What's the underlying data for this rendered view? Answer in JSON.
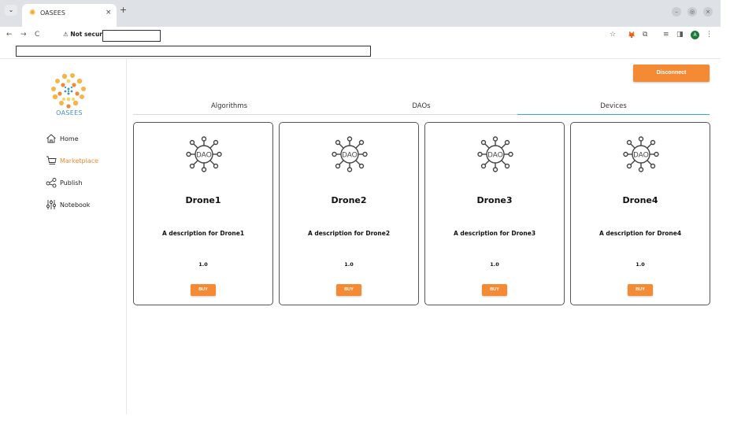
{
  "browser": {
    "tab_menu_icon": "chevron-down-icon",
    "tab_title": "OASEES",
    "tab_close": "×",
    "new_tab": "+",
    "nav": {
      "back": "←",
      "forward": "→",
      "reload": "C"
    },
    "security_label": "⚠ Not secure",
    "window_buttons": [
      "–",
      "◎",
      "×"
    ],
    "toolbar_icons": [
      "☆",
      "🦊",
      "⧉",
      "≡",
      "◨",
      "⋮"
    ],
    "profile_initial": "A"
  },
  "sidebar": {
    "logo_text": "OASEES",
    "items": [
      {
        "label": "Home",
        "icon": "home-icon",
        "active": false
      },
      {
        "label": "Marketplace",
        "icon": "cart-icon",
        "active": true
      },
      {
        "label": "Publish",
        "icon": "share-icon",
        "active": false
      },
      {
        "label": "Notebook",
        "icon": "sliders-icon",
        "active": false
      }
    ]
  },
  "header": {
    "disconnect_label": "Disconnect"
  },
  "tabs": [
    {
      "label": "Algorithms",
      "active": false
    },
    {
      "label": "DAOs",
      "active": false
    },
    {
      "label": "Devices",
      "active": true
    }
  ],
  "cards": [
    {
      "name": "Drone1",
      "description": "A description for Drone1",
      "version": "1.0",
      "buy_label": "BUY"
    },
    {
      "name": "Drone2",
      "description": "A description for Drone2",
      "version": "1.0",
      "buy_label": "BUY"
    },
    {
      "name": "Drone3",
      "description": "A description for Drone3",
      "version": "1.0",
      "buy_label": "BUY"
    },
    {
      "name": "Drone4",
      "description": "A description for Drone4",
      "version": "1.0",
      "buy_label": "BUY"
    }
  ],
  "colors": {
    "accent": "#f58a34",
    "tab_underline": "#3aa5c8",
    "logo_text": "#4a8fbf"
  }
}
